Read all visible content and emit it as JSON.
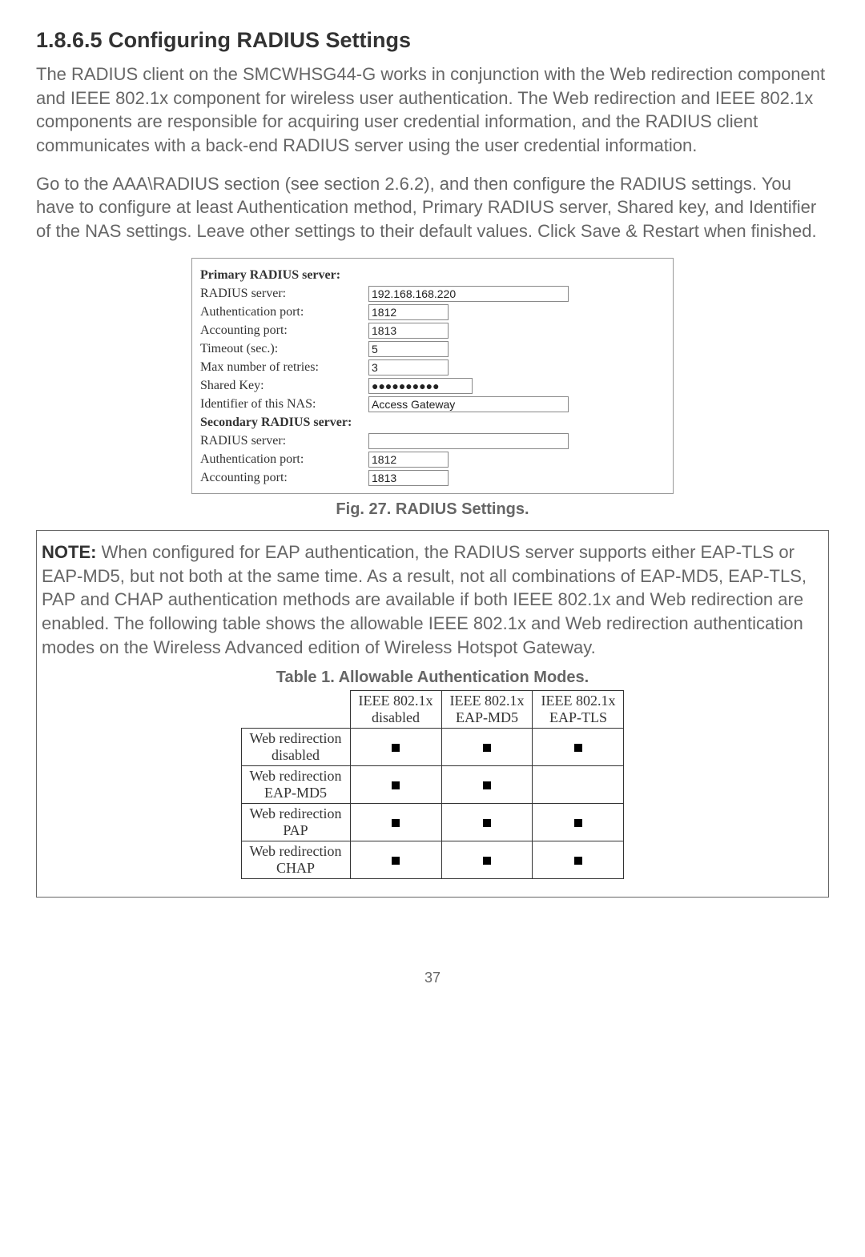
{
  "heading": "1.8.6.5 Configuring RADIUS Settings",
  "para1": "The RADIUS client on the SMCWHSG44-G works in conjunction with the Web redirection component and IEEE 802.1x component for wireless user authentication. The Web redirection and IEEE 802.1x components are responsible for acquiring user credential information, and the RADIUS client communicates with a back-end RADIUS server using the user credential information.",
  "para2": "Go to the AAA\\RADIUS section (see section 2.6.2), and then configure the RADIUS settings. You have to configure at least Authentication method, Primary RADIUS server, Shared key, and Identifier of the NAS settings. Leave other settings to their default values. Click Save & Restart when finished.",
  "fig": {
    "primary_header": "Primary RADIUS server:",
    "radius_server_label": "RADIUS server:",
    "radius_server_value": "192.168.168.220",
    "auth_port_label": "Authentication port:",
    "auth_port_value": "1812",
    "acct_port_label": "Accounting port:",
    "acct_port_value": "1813",
    "timeout_label": "Timeout (sec.):",
    "timeout_value": "5",
    "retries_label": "Max number of retries:",
    "retries_value": "3",
    "shared_key_label": "Shared Key:",
    "shared_key_value": "●●●●●●●●●●",
    "nas_id_label": "Identifier of this NAS:",
    "nas_id_value": "Access Gateway",
    "secondary_header": "Secondary RADIUS server:",
    "sec_radius_server_value": "",
    "sec_auth_port_value": "1812",
    "sec_acct_port_value": "1813"
  },
  "fig_caption": "Fig. 27. RADIUS Settings.",
  "note_label": "NOTE:",
  "note_text": " When configured for EAP authentication, the RADIUS server supports either EAP-TLS or EAP-MD5, but not both at the same time. As a result, not all combinations of EAP-MD5, EAP-TLS, PAP and CHAP authentication methods are available if both IEEE 802.1x and Web redirection are enabled. The following table shows the allowable IEEE 802.1x and Web redirection authentication modes on the Wireless Advanced edition of Wireless Hotspot Gateway.",
  "table_caption": "Table 1. Allowable Authentication Modes.",
  "table": {
    "col1a": "IEEE 802.1x",
    "col1b": "disabled",
    "col2a": "IEEE 802.1x",
    "col2b": "EAP-MD5",
    "col3a": "IEEE 802.1x",
    "col3b": "EAP-TLS",
    "r1a": "Web redirection",
    "r1b": "disabled",
    "r2a": "Web redirection",
    "r2b": "EAP-MD5",
    "r3a": "Web redirection",
    "r3b": "PAP",
    "r4a": "Web redirection",
    "r4b": "CHAP"
  },
  "chart_data": {
    "type": "table",
    "title": "Table 1. Allowable Authentication Modes.",
    "columns": [
      "IEEE 802.1x disabled",
      "IEEE 802.1x EAP-MD5",
      "IEEE 802.1x EAP-TLS"
    ],
    "rows": [
      "Web redirection disabled",
      "Web redirection EAP-MD5",
      "Web redirection PAP",
      "Web redirection CHAP"
    ],
    "values": [
      [
        true,
        true,
        true
      ],
      [
        true,
        true,
        false
      ],
      [
        true,
        true,
        true
      ],
      [
        true,
        true,
        true
      ]
    ]
  },
  "page_number": "37"
}
